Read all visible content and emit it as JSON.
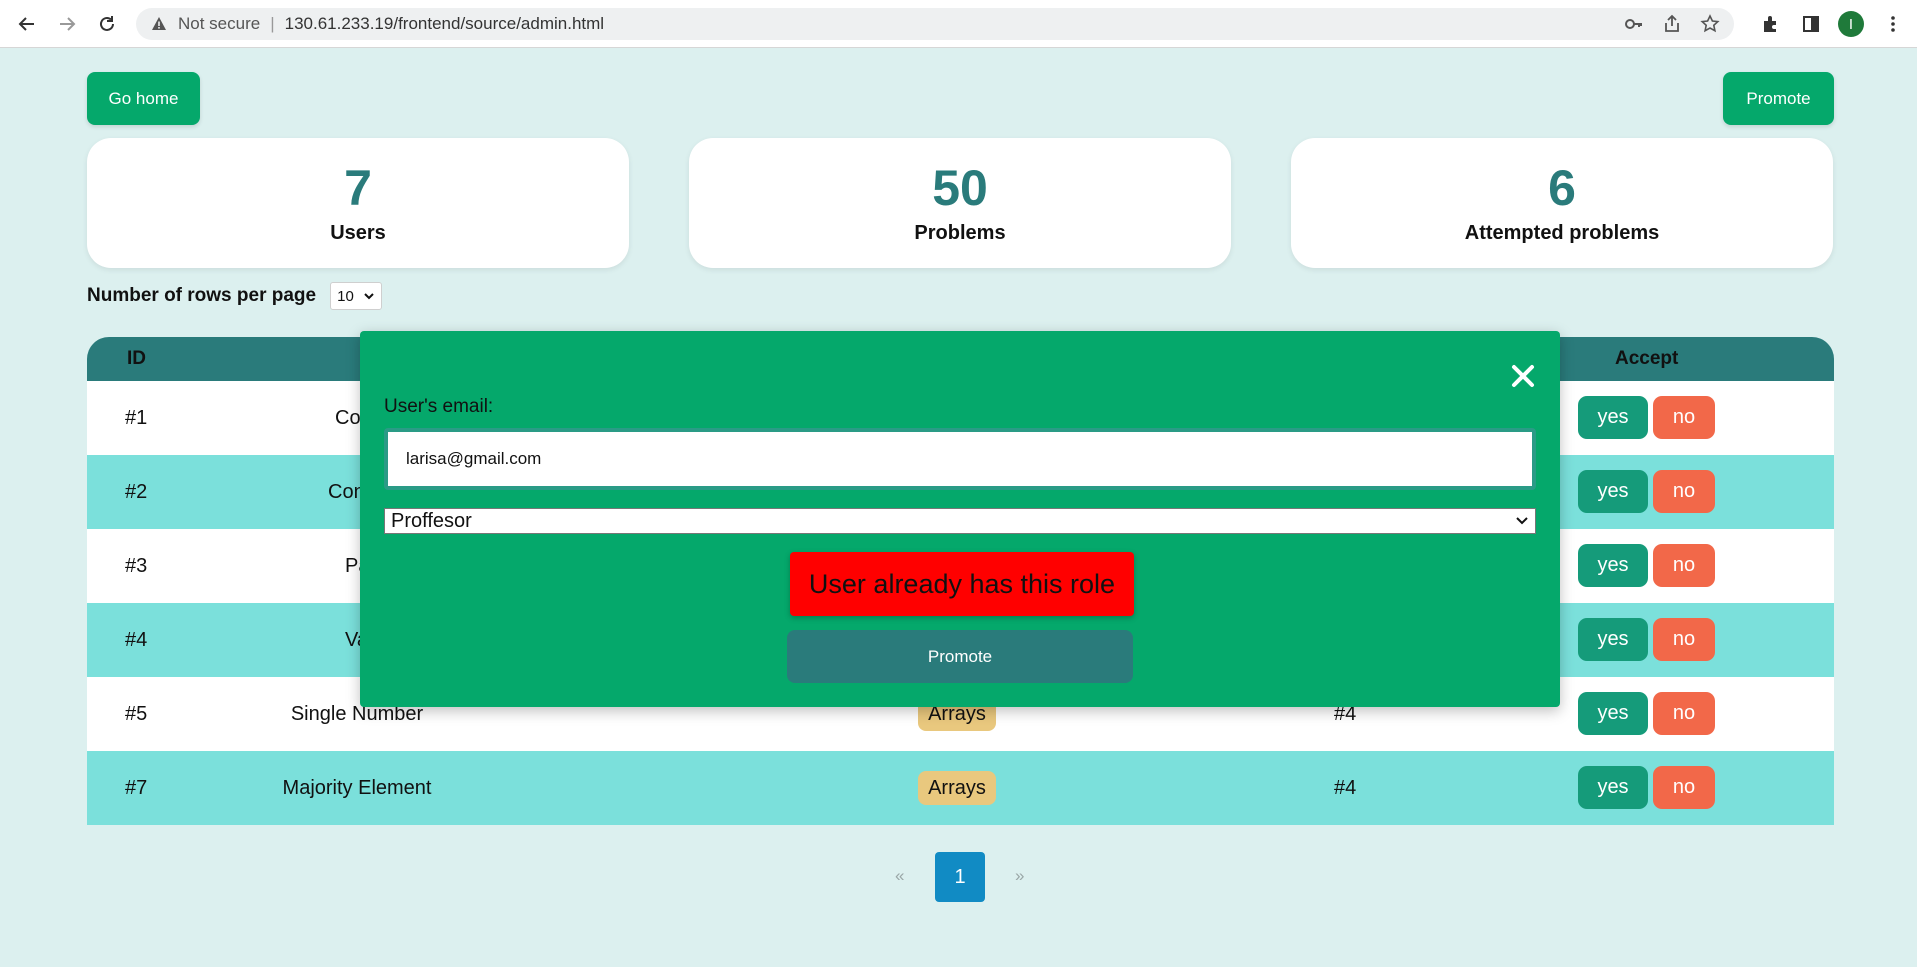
{
  "browser": {
    "security_label": "Not secure",
    "separator": "|",
    "url": "130.61.233.19/frontend/source/admin.html",
    "avatar_initial": "I"
  },
  "header": {
    "go_home_label": "Go home",
    "promote_label": "Promote"
  },
  "stats": [
    {
      "value": "7",
      "label": "Users"
    },
    {
      "value": "50",
      "label": "Problems"
    },
    {
      "value": "6",
      "label": "Attempted problems"
    }
  ],
  "rows_per_page": {
    "label": "Number of rows per page",
    "selected": "10"
  },
  "table": {
    "columns": [
      "ID",
      "Accept"
    ],
    "rows": [
      {
        "id": "#1",
        "title": "Co",
        "tag": "",
        "author": ""
      },
      {
        "id": "#2",
        "title": "Con",
        "tag": "",
        "author": ""
      },
      {
        "id": "#3",
        "title": "Pa",
        "tag": "",
        "author": ""
      },
      {
        "id": "#4",
        "title": "Va",
        "tag": "",
        "author": ""
      },
      {
        "id": "#5",
        "title": "Single Number",
        "tag": "Arrays",
        "author": "#4"
      },
      {
        "id": "#7",
        "title": "Majority Element",
        "tag": "Arrays",
        "author": "#4"
      }
    ],
    "yes_label": "yes",
    "no_label": "no"
  },
  "pagination": {
    "prev": "«",
    "current": "1",
    "next": "»"
  },
  "modal": {
    "email_label": "User's email:",
    "email_value": "larisa@gmail.com",
    "role_selected": "Proffesor",
    "error_message": "User already has this role",
    "promote_label": "Promote"
  },
  "colors": {
    "page_bg": "#dcf0ef",
    "primary_green": "#05a86b",
    "teal": "#2a7b7b",
    "row_alt": "#7be0db",
    "yes": "#159b7a",
    "no": "#f26849",
    "tag": "#e9c87e",
    "error": "#ff0000",
    "page_active": "#118bc4"
  }
}
